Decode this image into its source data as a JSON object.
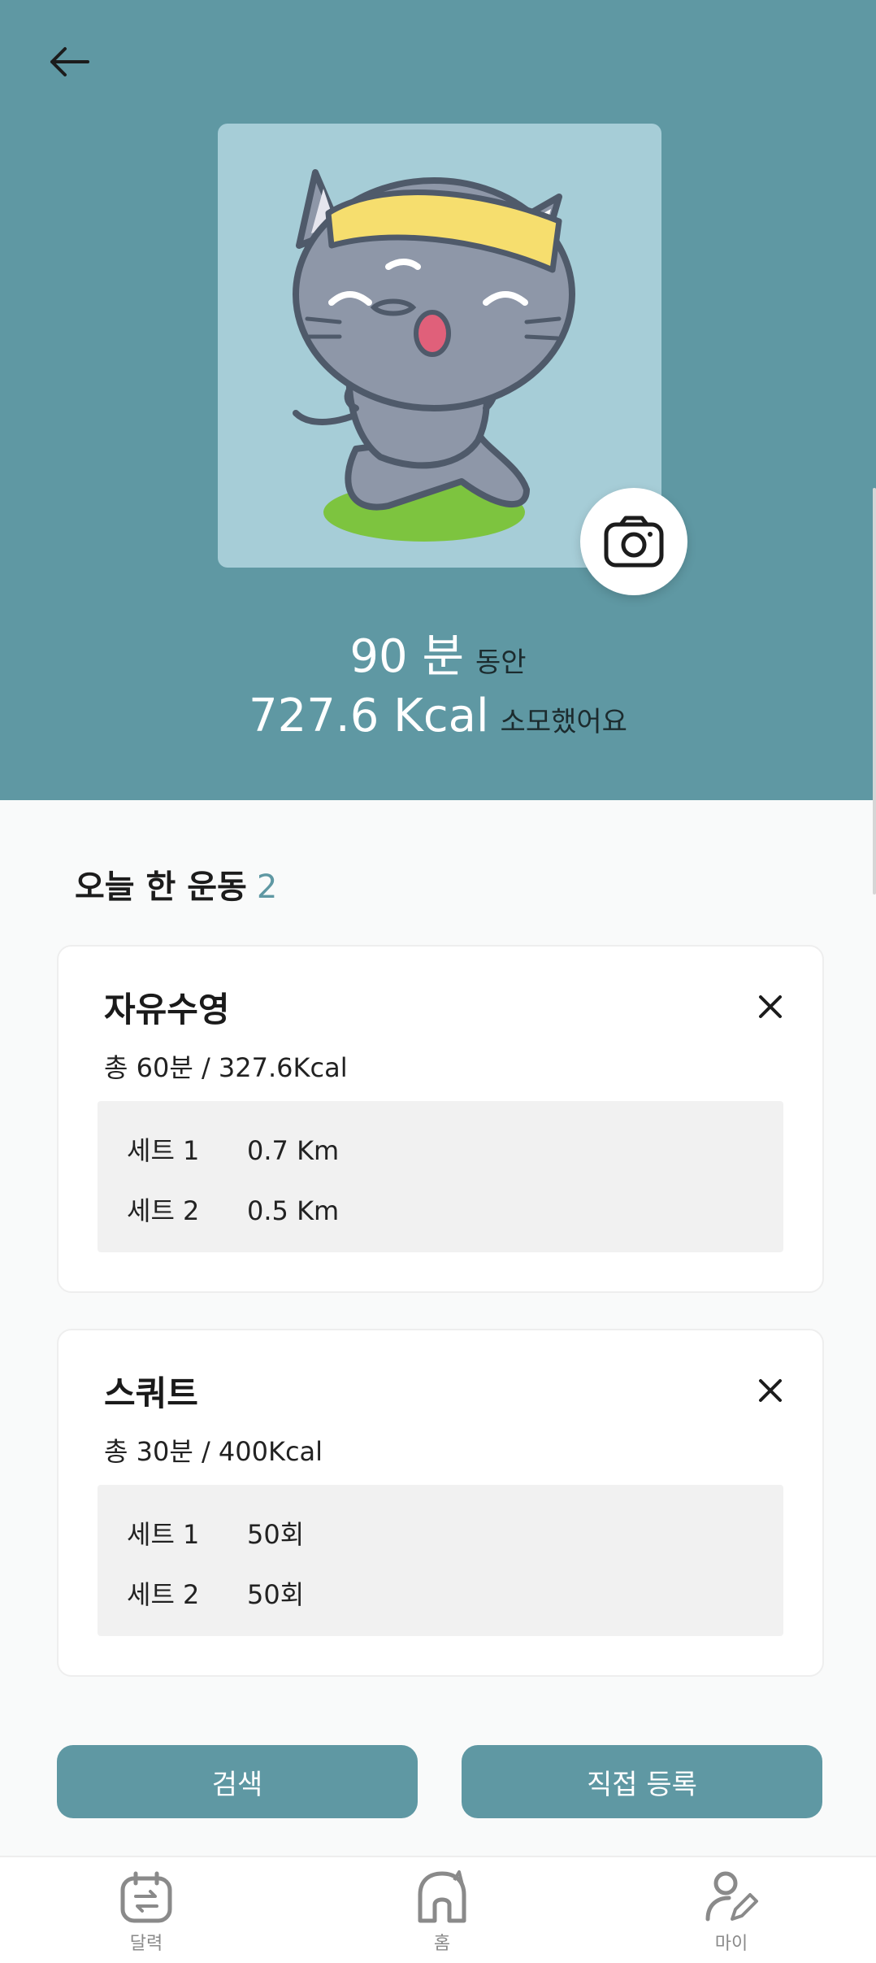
{
  "summary": {
    "minutes": "90 분",
    "minutes_suffix": "동안",
    "kcal": "727.6 Kcal",
    "kcal_suffix": "소모했어요"
  },
  "section": {
    "title": "오늘 한 운동",
    "count": "2"
  },
  "exercises": [
    {
      "name": "자유수영",
      "summary": "총 60분 / 327.6Kcal",
      "sets": [
        {
          "label": "세트 1",
          "value": "0.7 Km"
        },
        {
          "label": "세트 2",
          "value": "0.5 Km"
        }
      ]
    },
    {
      "name": "스쿼트",
      "summary": "총 30분 / 400Kcal",
      "sets": [
        {
          "label": "세트 1",
          "value": "50회"
        },
        {
          "label": "세트 2",
          "value": "50회"
        }
      ]
    }
  ],
  "buttons": {
    "search": "검색",
    "register": "직접 등록"
  },
  "nav": {
    "calendar": "달력",
    "home": "홈",
    "my": "마이"
  },
  "colors": {
    "accent": "#5f98a3",
    "photo_bg": "#a6cdd7"
  }
}
